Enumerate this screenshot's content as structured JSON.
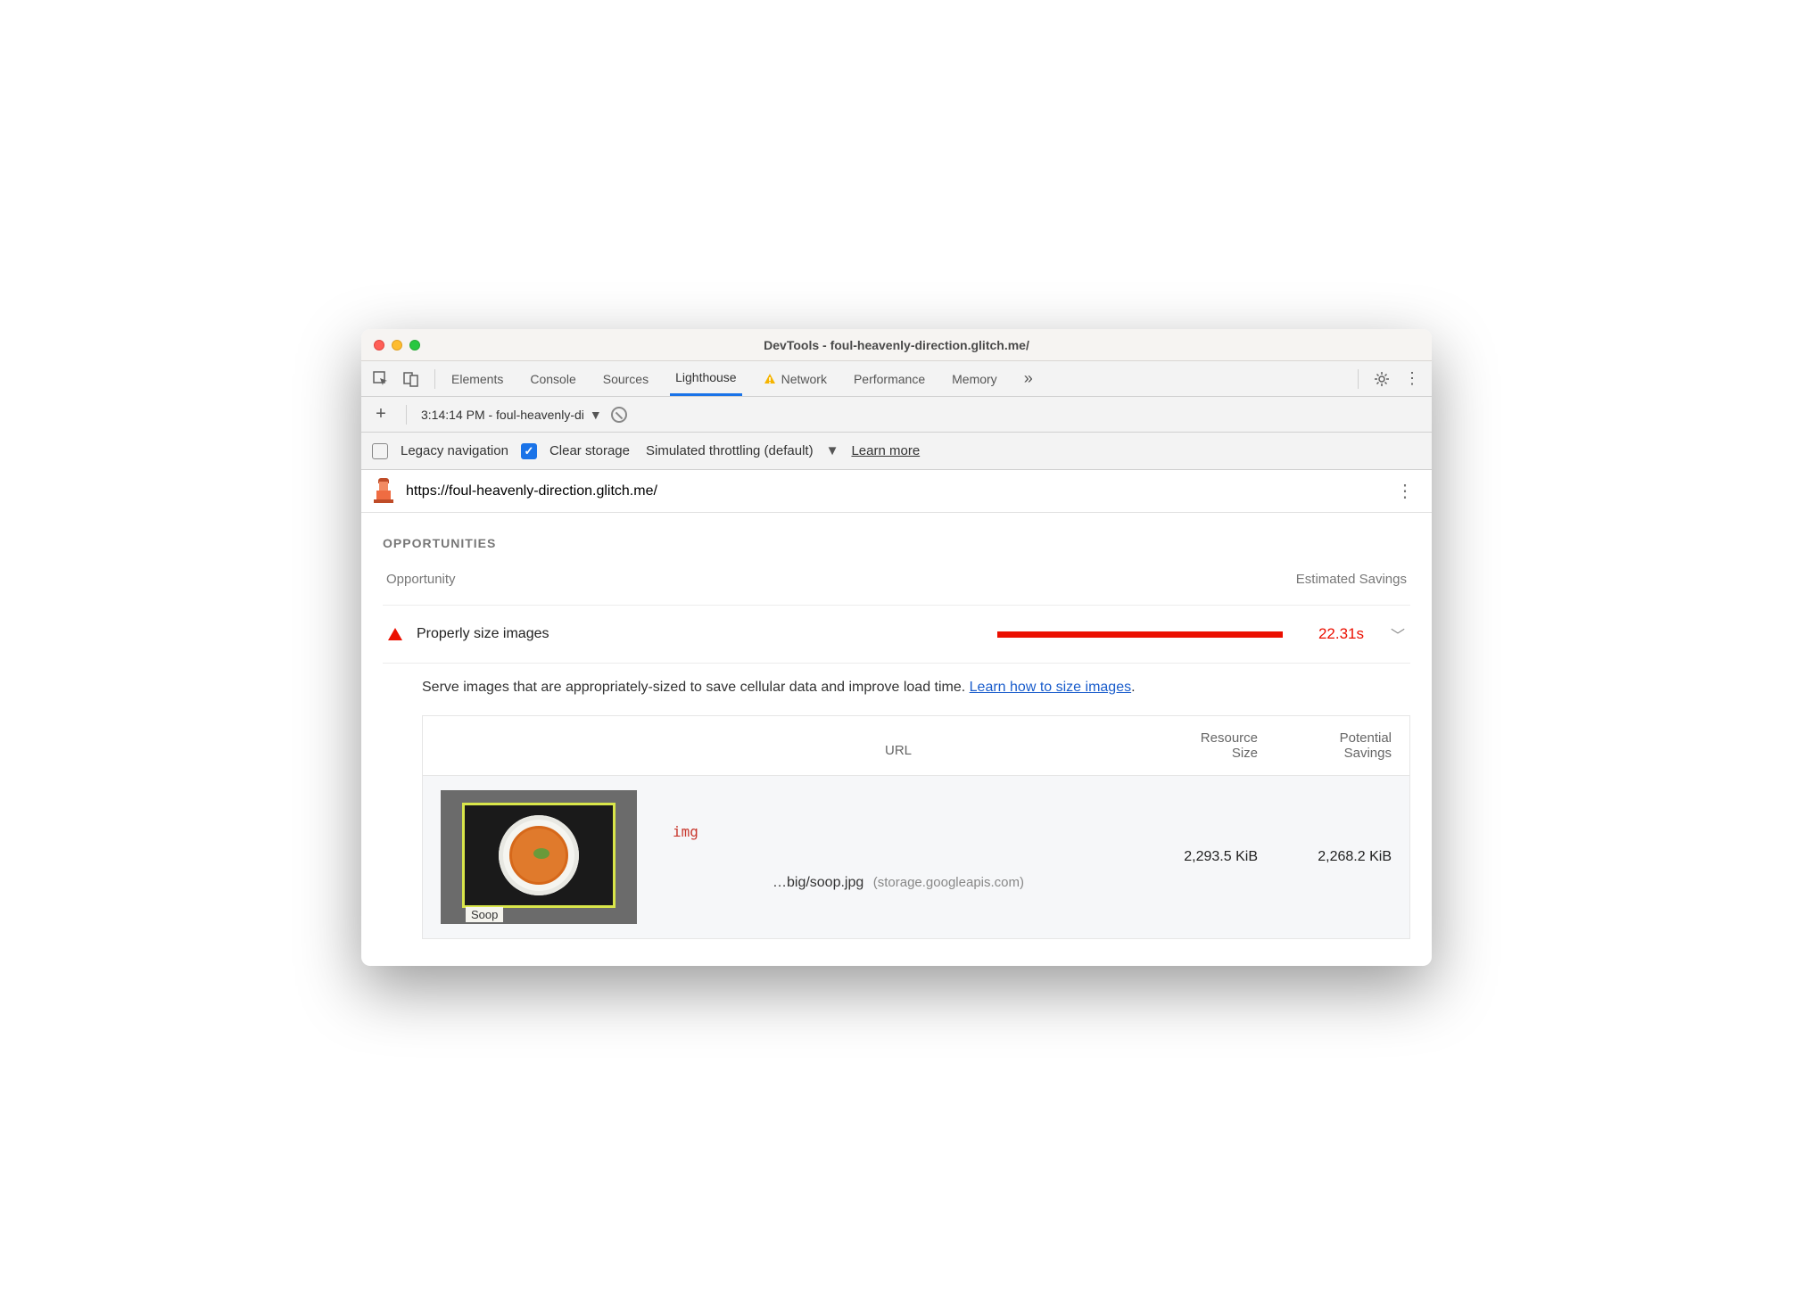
{
  "window": {
    "title": "DevTools - foul-heavenly-direction.glitch.me/"
  },
  "tabs": {
    "items": [
      {
        "label": "Elements"
      },
      {
        "label": "Console"
      },
      {
        "label": "Sources"
      },
      {
        "label": "Lighthouse"
      },
      {
        "label": "Network"
      },
      {
        "label": "Performance"
      },
      {
        "label": "Memory"
      }
    ],
    "activeIndex": 3
  },
  "historyBar": {
    "selected": "3:14:14 PM - foul-heavenly-di"
  },
  "options": {
    "legacy": {
      "label": "Legacy navigation",
      "checked": false
    },
    "clear": {
      "label": "Clear storage",
      "checked": true
    },
    "throttling": "Simulated throttling (default)",
    "learn": "Learn more"
  },
  "report": {
    "url": "https://foul-heavenly-direction.glitch.me/",
    "section": "OPPORTUNITIES",
    "headers": {
      "left": "Opportunity",
      "right": "Estimated Savings"
    },
    "audit": {
      "title": "Properly size images",
      "savings": "22.31s",
      "description": "Serve images that are appropriately-sized to save cellular data and improve load time. ",
      "link": "Learn how to size images"
    },
    "table": {
      "cols": {
        "url": "URL",
        "size_l1": "Resource",
        "size_l2": "Size",
        "sav_l1": "Potential",
        "sav_l2": "Savings"
      },
      "row": {
        "tag": "img",
        "path": "…big/soop.jpg",
        "host": "(storage.googleapis.com)",
        "size": "2,293.5 KiB",
        "savings": "2,268.2 KiB",
        "thumbLabel": "Soop"
      }
    }
  }
}
